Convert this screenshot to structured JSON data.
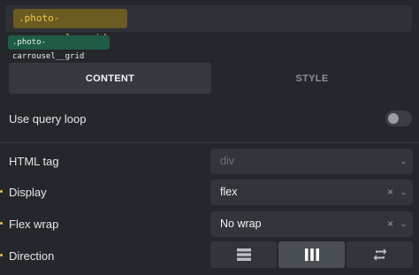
{
  "classes": {
    "input_chip": ".photo-carrousel__grid",
    "active_tag": ".photo-carrousel__grid"
  },
  "tabs": [
    {
      "label": "CONTENT",
      "active": true
    },
    {
      "label": "STYLE",
      "active": false
    }
  ],
  "query_loop": {
    "label": "Use query loop",
    "enabled": false
  },
  "html_tag": {
    "label": "HTML tag",
    "placeholder": "div"
  },
  "display": {
    "label": "Display",
    "value": "flex",
    "clear": "×",
    "chevron": "⌄"
  },
  "flex_wrap": {
    "label": "Flex wrap",
    "value": "No wrap",
    "clear": "×",
    "chevron": "⌄"
  },
  "direction": {
    "label": "Direction",
    "options": [
      {
        "icon": "rows-icon",
        "active": false
      },
      {
        "icon": "columns-icon",
        "active": true
      },
      {
        "icon": "reverse-icon",
        "active": false
      }
    ]
  },
  "colors": {
    "background": "#25272c",
    "chip_bg": "#6b5a22",
    "chip_text": "#f0c64a",
    "tag_bg": "#1f5c45",
    "bullet": "#f2c94c"
  }
}
